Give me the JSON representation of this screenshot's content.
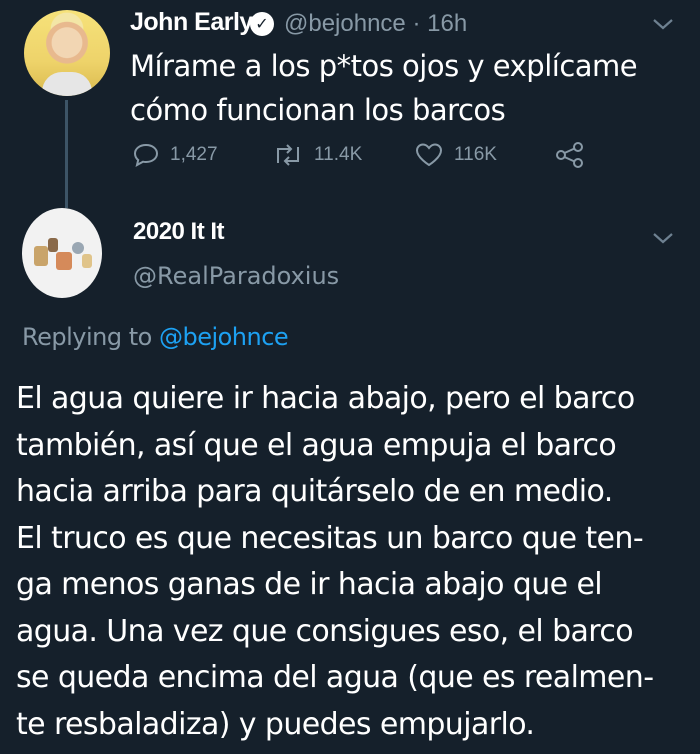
{
  "tweet": {
    "author_name": "John Early",
    "handle": "@bejohnce",
    "separator": "·",
    "time": "16h",
    "text": "Mírame a los p*tos ojos y explícame cómo funcionan los barcos",
    "stats": {
      "replies": "1,427",
      "retweets": "11.4K",
      "likes": "116K"
    }
  },
  "reply": {
    "author_name": "2020 It It",
    "handle": "@RealParadoxius",
    "replying_prefix": "Replying to",
    "replying_mention": "@bejohnce",
    "text": "El agua quiere ir hacia abajo, pero el barco\ntambién, así que el agua empuja el barco\nhacia arriba para quitárselo de en medio.\nEl truco es que necesitas un barco que ten-\nga menos ganas de ir hacia abajo que el\nagua. Una vez que consigues eso, el barco\nse queda encima del agua (que es realmen-\nte resbaladiza) y puedes empujarlo."
  },
  "colors": {
    "background": "#15202b",
    "text": "#ffffff",
    "muted": "#8899a6",
    "link": "#1da1f2"
  }
}
